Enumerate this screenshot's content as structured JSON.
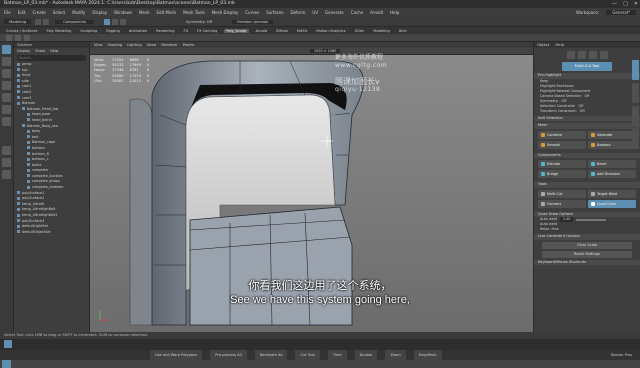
{
  "window": {
    "title": "Batman_LP_03.mb* - Autodesk MAYA 2024.1: C:\\Users\\kzb\\Desktop\\Batman\\scenes\\Batman_LP_03.mb",
    "buttons": [
      "—",
      "□",
      "✕"
    ]
  },
  "menubar": {
    "items": [
      "File",
      "Edit",
      "Create",
      "Select",
      "Modify",
      "Display",
      "Windows",
      "Mesh",
      "Edit Mesh",
      "Mesh Tools",
      "Mesh Display",
      "Curves",
      "Surfaces",
      "Deform",
      "UV",
      "Generate",
      "Cache",
      "Arnold",
      "Help"
    ],
    "workspace_label": "Workspace:",
    "workspace_value": "General*"
  },
  "status_line": {
    "mode": "Modeling",
    "search": "Components",
    "symmetry_label": "Symmetry: Off",
    "camera": "Freedom Joumala"
  },
  "shelf_tabs": {
    "items": [
      "Curves / Surfaces",
      "Poly Modeling",
      "Sculpting",
      "Rigging",
      "Animation",
      "Rendering",
      "FX",
      "FX Caching",
      "Poly_Sculpt",
      "Arnold",
      "Bifrost",
      "MASH",
      "Motion Graphics",
      "XGen",
      "Modeling",
      "Ahin"
    ],
    "active_index": 8
  },
  "outliner": {
    "header": "Outliner",
    "menu": [
      "Display",
      "Show",
      "Help"
    ],
    "search_placeholder": "Search...",
    "items": [
      {
        "label": "persp",
        "indent": 0
      },
      {
        "label": "top",
        "indent": 0
      },
      {
        "label": "front",
        "indent": 0
      },
      {
        "label": "side",
        "indent": 0
      },
      {
        "label": "cam1",
        "indent": 0
      },
      {
        "label": "cam2",
        "indent": 0
      },
      {
        "label": "cam3",
        "indent": 0
      },
      {
        "label": "Batman",
        "indent": 0
      },
      {
        "label": "Batman_Head_low",
        "indent": 1
      },
      {
        "label": "head_base",
        "indent": 2
      },
      {
        "label": "head_blend",
        "indent": 2
      },
      {
        "label": "Batman_Body_low",
        "indent": 1
      },
      {
        "label": "body",
        "indent": 2
      },
      {
        "label": "belt",
        "indent": 2
      },
      {
        "label": "Batman_cape",
        "indent": 2
      },
      {
        "label": "buttons",
        "indent": 2
      },
      {
        "label": "buttons_R",
        "indent": 2
      },
      {
        "label": "buttons_L",
        "indent": 2
      },
      {
        "label": "boots",
        "indent": 2
      },
      {
        "label": "complete",
        "indent": 2
      },
      {
        "label": "complete_buckles",
        "indent": 2
      },
      {
        "label": "complete_straps",
        "indent": 2
      },
      {
        "label": "complete_emblem",
        "indent": 2
      },
      {
        "label": "polySurface1",
        "indent": 0
      },
      {
        "label": "polySurface2",
        "indent": 0
      },
      {
        "label": "temp_Ultrafit",
        "indent": 0
      },
      {
        "label": "temp_UltraHighBelt",
        "indent": 0
      },
      {
        "label": "temp_UltraHighBelt1",
        "indent": 0
      },
      {
        "label": "polySurface3",
        "indent": 0
      },
      {
        "label": "defaultLightSet",
        "indent": 0
      },
      {
        "label": "defaultObjectSet",
        "indent": 0
      }
    ]
  },
  "viewport": {
    "menu": [
      "View",
      "Shading",
      "Lighting",
      "Show",
      "Renderer",
      "Panels"
    ],
    "hud": {
      "rows": [
        {
          "label": "Verts:",
          "a": "27051",
          "b": "8868",
          "c": "0"
        },
        {
          "label": "Edges:",
          "a": "54232",
          "b": "17649",
          "c": "0"
        },
        {
          "label": "Faces:",
          "a": "27248",
          "b": "8787",
          "c": "0"
        },
        {
          "label": "Tris:",
          "a": "54060",
          "b": "17574",
          "c": "0"
        },
        {
          "label": "UVs:",
          "a": "35081",
          "b": "11015",
          "c": "0"
        }
      ]
    },
    "resolution_label": "1920 × 1080",
    "watermark": {
      "line1": "更多海外优质教程",
      "line2": "www.cgltg.com",
      "line3": "国课加图长v",
      "line4": "qiqiyu·12138"
    }
  },
  "attribute_panel": {
    "menu": [
      "Object",
      "Help"
    ],
    "tool_name": "Multi-Cut Tool",
    "sections": {
      "preselect_title": "Pre-Highlight",
      "preselect_items": [
        "Keep",
        "Highlight Backfaces",
        "Highlight Nearest Component"
      ],
      "camera_label": "Camera Based Selection",
      "camera_value": "Off",
      "symmetry_label": "Symmetry:",
      "symmetry_value": "Off",
      "selection_constraint_label": "Selection Constraint:",
      "selection_constraint_value": "Off",
      "transform_constraint_label": "Transform Constraint:",
      "transform_constraint_value": "Off",
      "soft_selection": "Soft Selection",
      "mesh_title": "Mesh",
      "mesh_tools": [
        "Combine",
        "Separate",
        "Smooth",
        "Boolean"
      ],
      "components_title": "Components",
      "component_tools": [
        "Extrude",
        "Bevel",
        "Bridge",
        "Add Divisions"
      ],
      "tools_title": "Tools",
      "tool_items": [
        "Multi-Cut",
        "Target Weld",
        "Connect",
        "Quad Draw"
      ],
      "quad_draw_title": "Quad Draw Options",
      "auto_weld_label": "Auto weld",
      "auto_weld_value": "2.00",
      "auto_weld_label2": "Auto weld",
      "relax_label": "Relax: Free",
      "button_clear": "Clear Scale",
      "button_reset": "Reset Settings",
      "keyboard": "Keyboard/Mouse Shortcuts",
      "live_constraint": "Live Constraint Options"
    }
  },
  "command_line": {
    "text": "Select Tool: click LMB to drag or SHIFT to increment. Shift to constrain selection."
  },
  "bottom_bar": {
    "items": [
      "Use and Warp Polygons",
      "Pre-process All",
      "Decimate All",
      "Cut Tool",
      "Time",
      "Double",
      "Zoom",
      "EasyMesh"
    ],
    "right_label": "Boxum Plus"
  },
  "subtitles": {
    "chinese": "你看我们这边用了这个系统，",
    "english": "See we have this system going here,"
  },
  "colors": {
    "accent": "#5d8fb3",
    "panel": "#3e3e3e",
    "viewport_bg": "#7c7c7c"
  }
}
